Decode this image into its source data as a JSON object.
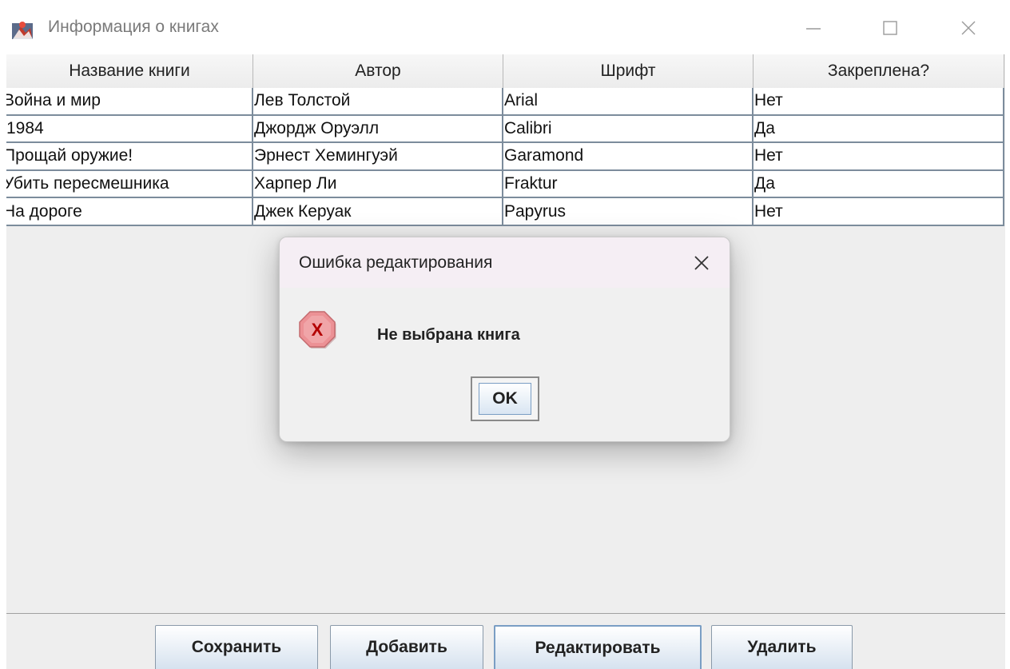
{
  "window": {
    "title": "Информация о книгах",
    "icon": "java-app-icon"
  },
  "table": {
    "columns": [
      "Название книги",
      "Автор",
      "Шрифт",
      "Закреплена?"
    ],
    "rows": [
      [
        "Война и мир",
        "Лев Толстой",
        "Arial",
        "Нет"
      ],
      [
        "1984",
        "Джордж Оруэлл",
        "Calibri",
        "Да"
      ],
      [
        "Прощай оружие!",
        "Эрнест Хемингуэй",
        "Garamond",
        "Нет"
      ],
      [
        "Убить пересмешника",
        "Харпер Ли",
        "Fraktur",
        "Да"
      ],
      [
        "На дороге",
        "Джек Керуак",
        "Papyrus",
        "Нет"
      ]
    ]
  },
  "buttons": {
    "save": "Сохранить",
    "add": "Добавить",
    "edit": "Редактировать",
    "delete": "Удалить"
  },
  "dialog": {
    "title": "Ошибка редактирования",
    "message": "Не выбрана книга",
    "ok": "OK",
    "icon": "error-icon"
  },
  "colors": {
    "grid_line": "#7c8c9c",
    "button_gradient_bottom": "#d6e2ef",
    "dialog_header": "#f5eef4",
    "error_icon_fill": "#e9888c"
  }
}
